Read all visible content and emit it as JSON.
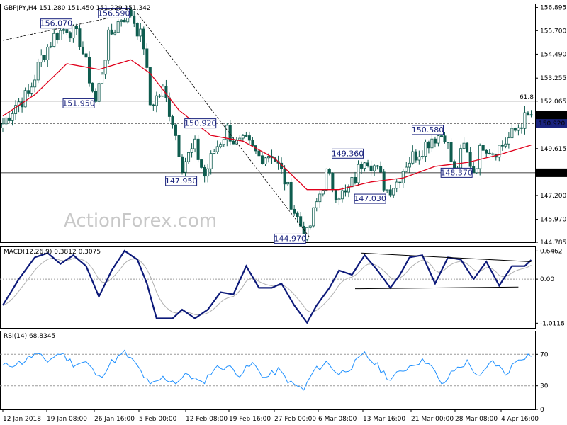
{
  "chart_data": [
    {
      "type": "candlestick",
      "panel": "price",
      "title": "GBPJPY,H4  151.280 151.450 151.229 151.342",
      "ylim": [
        144.785,
        157.1
      ],
      "y_ticks": [
        "156.895",
        "155.700",
        "154.490",
        "153.255",
        "152.065",
        "150.820",
        "149.615",
        "148.370",
        "147.200",
        "145.970",
        "144.785"
      ],
      "current_price": "151.342",
      "price_tags": [
        {
          "label": "151.342",
          "value": 151.342,
          "color": "#000000"
        },
        {
          "label": "150.920",
          "value": 150.92,
          "color": "#1a237e"
        },
        {
          "label": "148.370",
          "value": 148.37,
          "color": "#000000"
        }
      ],
      "annotations": [
        {
          "label": "156.590",
          "x": 40,
          "y": 156.59
        },
        {
          "label": "156.070",
          "x": 22,
          "y": 156.07
        },
        {
          "label": "151.950",
          "x": 29,
          "y": 151.95
        },
        {
          "label": "150.920",
          "x": 67,
          "y": 150.92
        },
        {
          "label": "147.950",
          "x": 61,
          "y": 147.95
        },
        {
          "label": "144.970",
          "x": 95,
          "y": 144.97
        },
        {
          "label": "149.360",
          "x": 113,
          "y": 149.36
        },
        {
          "label": "147.030",
          "x": 120,
          "y": 147.03
        },
        {
          "label": "150.580",
          "x": 138,
          "y": 150.58
        },
        {
          "label": "148.370",
          "x": 147,
          "y": 148.37
        }
      ],
      "horizontal_lines": [
        {
          "value": 152.065,
          "style": "solid",
          "label": "61.8"
        },
        {
          "value": 150.92,
          "style": "dashed"
        },
        {
          "value": 148.37,
          "style": "solid"
        },
        {
          "value": 151.342,
          "style": "solid"
        }
      ],
      "price_keypoints": [
        [
          0,
          150.9
        ],
        [
          4,
          151.9
        ],
        [
          8,
          152.4
        ],
        [
          12,
          154.3
        ],
        [
          16,
          155.4
        ],
        [
          20,
          155.9
        ],
        [
          24,
          155.2
        ],
        [
          29,
          152.0
        ],
        [
          33,
          155.3
        ],
        [
          37,
          156.4
        ],
        [
          40,
          156.6
        ],
        [
          44,
          155.0
        ],
        [
          46,
          151.9
        ],
        [
          50,
          152.6
        ],
        [
          53,
          151.1
        ],
        [
          56,
          148.8
        ],
        [
          60,
          149.7
        ],
        [
          63,
          148.2
        ],
        [
          66,
          149.5
        ],
        [
          70,
          150.6
        ],
        [
          73,
          149.8
        ],
        [
          76,
          149.9
        ],
        [
          80,
          149.2
        ],
        [
          84,
          149.4
        ],
        [
          88,
          148.0
        ],
        [
          91,
          146.4
        ],
        [
          94,
          145.3
        ],
        [
          95,
          145.1
        ],
        [
          98,
          146.8
        ],
        [
          101,
          148.3
        ],
        [
          104,
          147.4
        ],
        [
          107,
          147.2
        ],
        [
          110,
          148.1
        ],
        [
          113,
          149.3
        ],
        [
          116,
          148.7
        ],
        [
          120,
          147.5
        ],
        [
          123,
          147.9
        ],
        [
          126,
          148.9
        ],
        [
          130,
          149.5
        ],
        [
          134,
          150.2
        ],
        [
          138,
          150.4
        ],
        [
          141,
          148.3
        ],
        [
          144,
          149.7
        ],
        [
          147,
          148.5
        ],
        [
          150,
          149.9
        ],
        [
          153,
          149.5
        ],
        [
          156,
          149.8
        ],
        [
          159,
          150.3
        ],
        [
          162,
          151.0
        ],
        [
          165,
          151.34
        ]
      ],
      "ema_keypoints": [
        [
          0,
          151.3
        ],
        [
          10,
          152.4
        ],
        [
          20,
          154.0
        ],
        [
          30,
          153.7
        ],
        [
          40,
          154.2
        ],
        [
          46,
          153.5
        ],
        [
          55,
          151.6
        ],
        [
          65,
          150.3
        ],
        [
          75,
          150.0
        ],
        [
          85,
          149.1
        ],
        [
          95,
          147.5
        ],
        [
          105,
          147.5
        ],
        [
          115,
          147.9
        ],
        [
          125,
          148.1
        ],
        [
          135,
          148.7
        ],
        [
          145,
          148.9
        ],
        [
          155,
          149.3
        ],
        [
          165,
          149.8
        ]
      ],
      "trendlines": [
        {
          "from": [
            0,
            155.2
          ],
          "to": [
            40,
            156.6
          ],
          "style": "dashed"
        },
        {
          "from": [
            42,
            156.6
          ],
          "to": [
            96,
            145.0
          ],
          "style": "dashed"
        }
      ],
      "watermark": "ActionForex.com"
    },
    {
      "type": "line",
      "panel": "macd",
      "title": "MACD(12,26,9) 0.3812 0.3075",
      "ylim": [
        -1.12,
        0.75
      ],
      "y_ticks": [
        "0.6462",
        "0.00",
        "-1.0118"
      ],
      "series": [
        {
          "name": "MACD",
          "color": "#0d1a7a"
        },
        {
          "name": "Signal",
          "color": "#b0b0b0"
        }
      ],
      "macd_keypoints": [
        [
          0,
          -0.6
        ],
        [
          5,
          0.0
        ],
        [
          10,
          0.5
        ],
        [
          14,
          0.6
        ],
        [
          18,
          0.35
        ],
        [
          22,
          0.55
        ],
        [
          26,
          0.3
        ],
        [
          30,
          -0.4
        ],
        [
          34,
          0.2
        ],
        [
          38,
          0.65
        ],
        [
          42,
          0.45
        ],
        [
          45,
          -0.1
        ],
        [
          48,
          -0.9
        ],
        [
          53,
          -0.9
        ],
        [
          56,
          -0.7
        ],
        [
          60,
          -0.9
        ],
        [
          64,
          -0.7
        ],
        [
          68,
          -0.3
        ],
        [
          72,
          -0.35
        ],
        [
          76,
          0.3
        ],
        [
          80,
          -0.2
        ],
        [
          84,
          -0.2
        ],
        [
          87,
          -0.1
        ],
        [
          91,
          -0.6
        ],
        [
          95,
          -1.0
        ],
        [
          98,
          -0.6
        ],
        [
          102,
          -0.2
        ],
        [
          105,
          0.2
        ],
        [
          109,
          0.1
        ],
        [
          113,
          0.55
        ],
        [
          117,
          0.2
        ],
        [
          121,
          -0.2
        ],
        [
          124,
          0.1
        ],
        [
          127,
          0.5
        ],
        [
          131,
          0.55
        ],
        [
          135,
          -0.1
        ],
        [
          139,
          0.5
        ],
        [
          143,
          0.45
        ],
        [
          147,
          0.0
        ],
        [
          151,
          0.4
        ],
        [
          155,
          -0.15
        ],
        [
          159,
          0.3
        ],
        [
          163,
          0.3
        ],
        [
          165,
          0.44
        ]
      ],
      "trendlines": [
        {
          "from": [
            112,
            0.6
          ],
          "to": [
            165,
            0.4
          ]
        },
        {
          "from": [
            110,
            -0.22
          ],
          "to": [
            161,
            -0.18
          ]
        }
      ]
    },
    {
      "type": "line",
      "panel": "rsi",
      "title": "RSI(14) 68.8345",
      "ylim": [
        0,
        100
      ],
      "y_ticks": [
        "70",
        "30",
        "0"
      ],
      "levels": [
        70,
        30
      ],
      "rsi_keypoints": [
        [
          0,
          55
        ],
        [
          6,
          60
        ],
        [
          10,
          70
        ],
        [
          14,
          62
        ],
        [
          18,
          72
        ],
        [
          22,
          58
        ],
        [
          26,
          60
        ],
        [
          30,
          40
        ],
        [
          34,
          60
        ],
        [
          38,
          72
        ],
        [
          42,
          55
        ],
        [
          46,
          30
        ],
        [
          50,
          40
        ],
        [
          54,
          35
        ],
        [
          58,
          45
        ],
        [
          62,
          32
        ],
        [
          66,
          52
        ],
        [
          70,
          55
        ],
        [
          74,
          45
        ],
        [
          78,
          58
        ],
        [
          82,
          40
        ],
        [
          86,
          50
        ],
        [
          90,
          33
        ],
        [
          94,
          25
        ],
        [
          97,
          48
        ],
        [
          101,
          60
        ],
        [
          105,
          45
        ],
        [
          109,
          55
        ],
        [
          113,
          70
        ],
        [
          117,
          55
        ],
        [
          121,
          38
        ],
        [
          125,
          50
        ],
        [
          129,
          60
        ],
        [
          133,
          62
        ],
        [
          137,
          30
        ],
        [
          141,
          50
        ],
        [
          145,
          60
        ],
        [
          149,
          40
        ],
        [
          153,
          62
        ],
        [
          157,
          45
        ],
        [
          161,
          65
        ],
        [
          165,
          70
        ]
      ]
    }
  ],
  "x_axis": {
    "labels": [
      "12 Jan 2018",
      "19 Jan 08:00",
      "26 Jan 16:00",
      "5 Feb 00:00",
      "12 Feb 08:00",
      "19 Feb 16:00",
      "27 Feb 00:00",
      "6 Mar 08:00",
      "13 Mar 16:00",
      "21 Mar 00:00",
      "28 Mar 08:00",
      "4 Apr 16:00"
    ]
  },
  "colors": {
    "ema": "#e0001b",
    "candle": "#0f5c4f",
    "macd": "#0d1a7a",
    "signal": "#b0b0b0",
    "rsi": "#1e90ff",
    "annotation": "#1a237e"
  }
}
